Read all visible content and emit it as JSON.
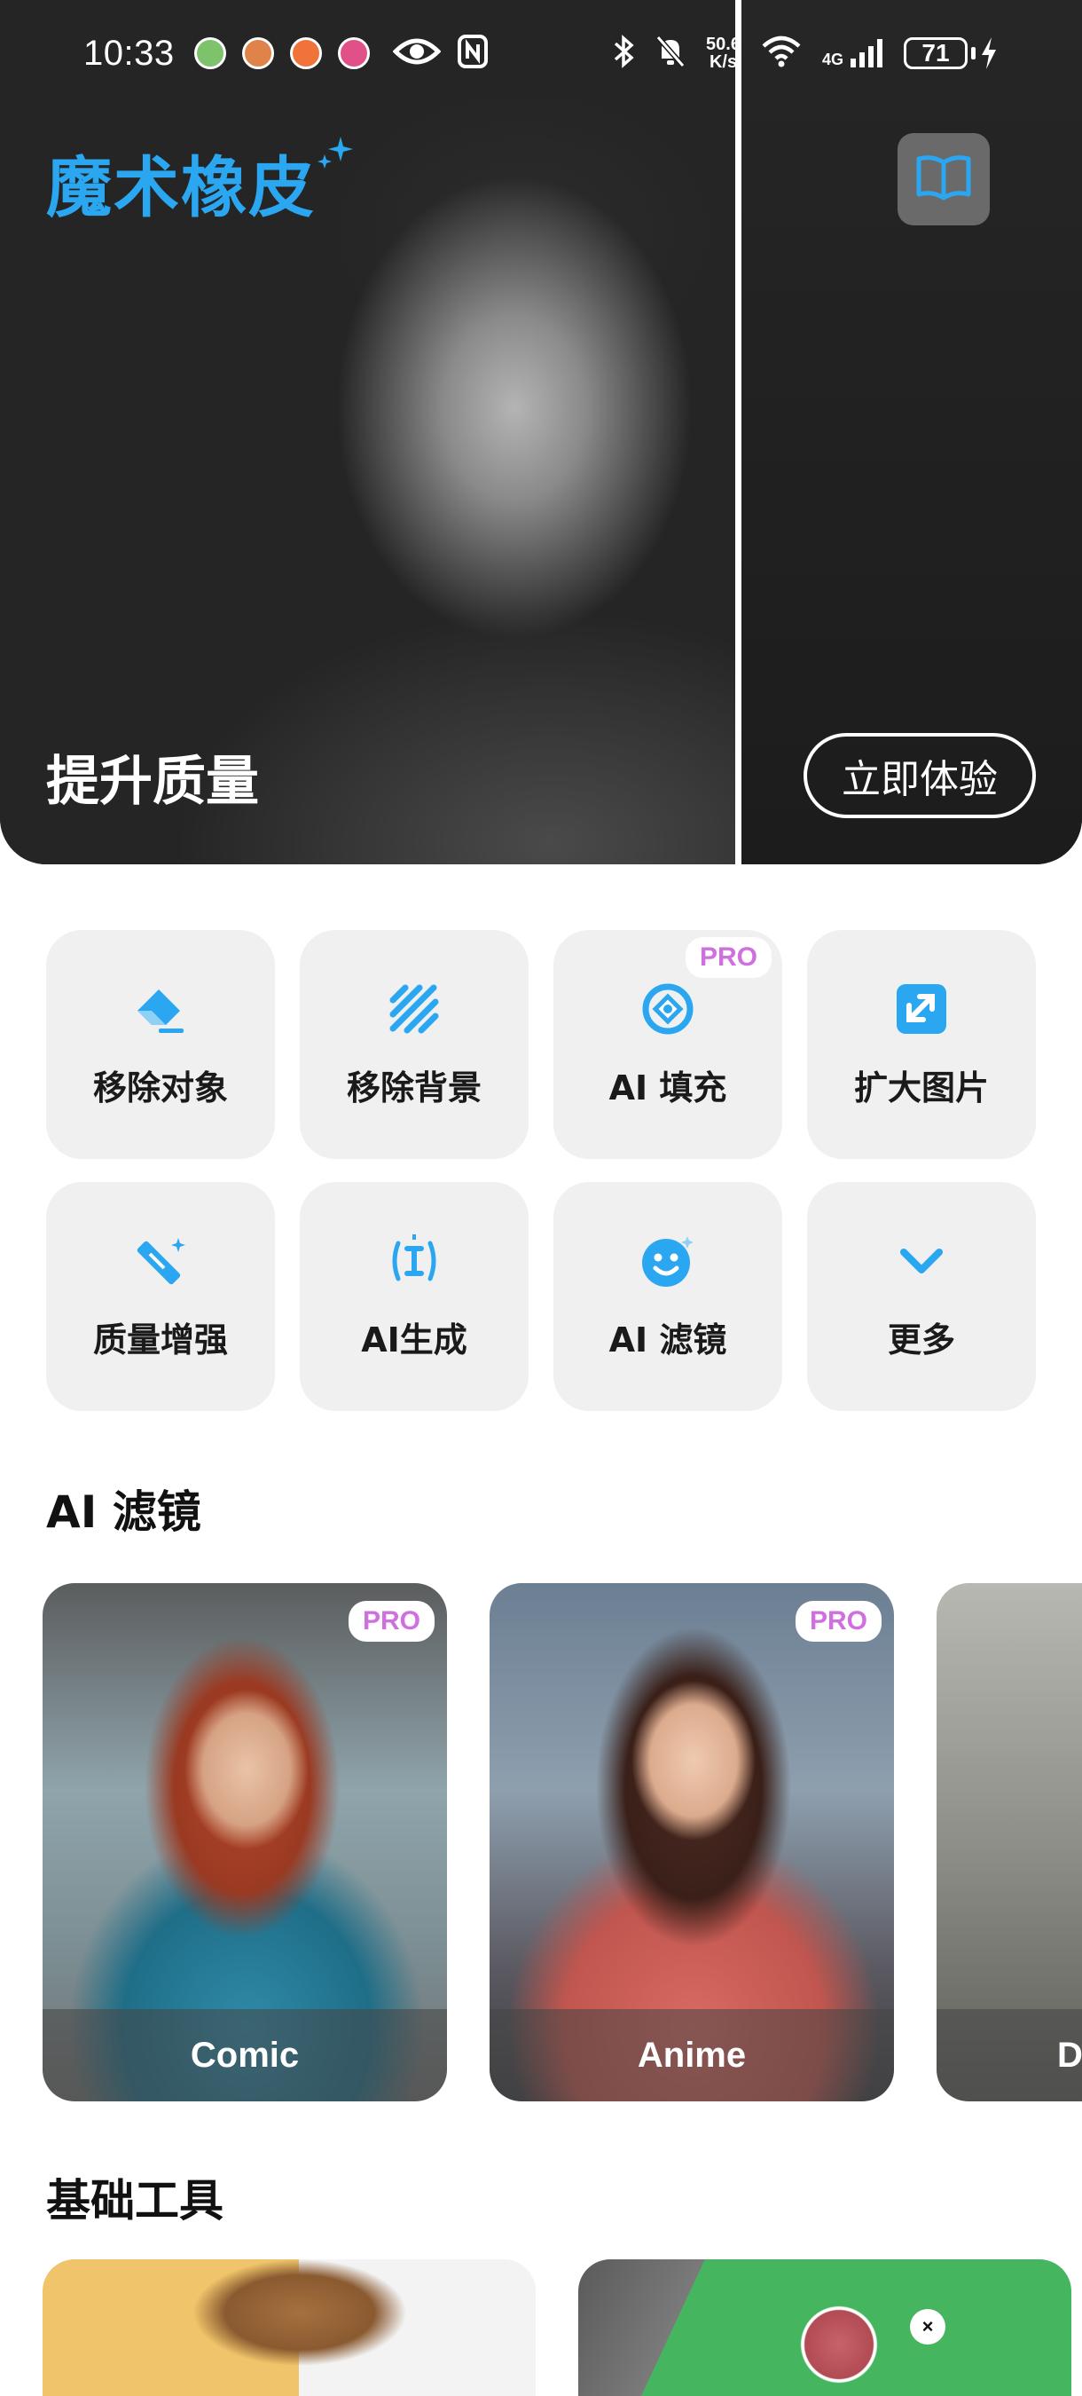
{
  "status_bar": {
    "time": "10:33",
    "speed_value": "50.6",
    "speed_unit": "K/s",
    "network": "4G",
    "battery": "71"
  },
  "hero": {
    "app_name": "魔术橡皮",
    "title": "提升质量",
    "try_button": "立即体验"
  },
  "tools": [
    {
      "label": "移除对象",
      "icon": "eraser-icon",
      "pro": false
    },
    {
      "label": "移除背景",
      "icon": "stripes-icon",
      "pro": false
    },
    {
      "label": "AI 填充",
      "icon": "ai-fill-icon",
      "pro": true
    },
    {
      "label": "扩大图片",
      "icon": "expand-image-icon",
      "pro": false
    },
    {
      "label": "质量增强",
      "icon": "magic-wand-icon",
      "pro": false
    },
    {
      "label": "AI生成",
      "icon": "text-cursor-icon",
      "pro": false
    },
    {
      "label": "AI 滤镜",
      "icon": "smiley-icon",
      "pro": false
    },
    {
      "label": "更多",
      "icon": "chevron-down-icon",
      "pro": false
    }
  ],
  "pro_label": "PRO",
  "filters_section": {
    "title": "AI 滤镜",
    "items": [
      {
        "label": "Comic",
        "pro": true
      },
      {
        "label": "Anime",
        "pro": true
      },
      {
        "label": "D",
        "pro": false
      }
    ]
  },
  "basic_section": {
    "title": "基础工具",
    "close_glyph": "×"
  },
  "colors": {
    "accent": "#2aa7f0",
    "pro_gradient": [
      "#d06fe0",
      "#5aa8f5"
    ],
    "tile_bg": "#f0f0f0"
  }
}
